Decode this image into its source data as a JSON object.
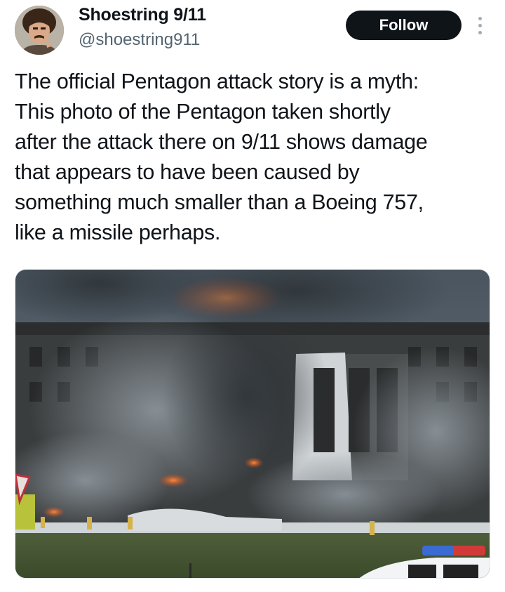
{
  "author": {
    "display_name": "Shoestring 9/11",
    "handle": "@shoestring911",
    "avatar_icon": "user-avatar"
  },
  "actions": {
    "follow_label": "Follow",
    "more_icon": "more-vertical-icon"
  },
  "tweet": {
    "text_lines": [
      "The official Pentagon attack story is a myth:",
      "This photo of the Pentagon taken shortly",
      "after the attack there on 9/11 shows damage",
      "that appears to have been caused by",
      "something much smaller than a Boeing 757,",
      "like a missile perhaps."
    ]
  },
  "media": {
    "type": "photo"
  },
  "colors": {
    "text": "#0f1419",
    "secondary_text": "#536471",
    "follow_bg": "#0f1419",
    "follow_text": "#ffffff"
  }
}
